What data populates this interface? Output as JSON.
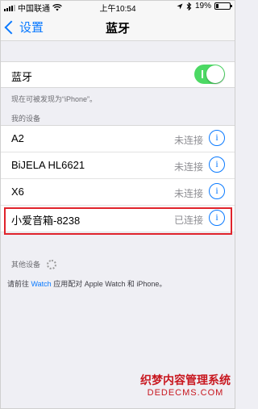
{
  "status_bar": {
    "carrier": "中国联通",
    "time": "上午10:54",
    "battery_text": "19%",
    "battery_level": 0.19,
    "icons": [
      "signal-icon",
      "wifi-icon",
      "location-icon",
      "bluetooth-icon",
      "battery-icon"
    ]
  },
  "nav": {
    "back_label": "设置",
    "title": "蓝牙"
  },
  "bluetooth": {
    "label": "蓝牙",
    "enabled": true
  },
  "discoverable_text": "现在可被发现为“iPhone”。",
  "my_devices": {
    "header": "我的设备",
    "items": [
      {
        "name": "A2",
        "status": "未连接"
      },
      {
        "name": "BiJELA HL6621",
        "status": "未连接"
      },
      {
        "name": "X6",
        "status": "未连接"
      },
      {
        "name": "小爱音箱-8238",
        "status": "已连接"
      }
    ]
  },
  "other_devices_header": "其他设备",
  "watch_hint": {
    "prefix": "请前往 ",
    "link": "Watch",
    "suffix": " 应用配对 Apple Watch 和 iPhone。"
  },
  "watermark": {
    "line1": "织梦内容管理系统",
    "line2": "DEDECMS.COM"
  },
  "colors": {
    "accent": "#0a7aff",
    "toggle_on": "#4cd964",
    "highlight": "#e0232b",
    "background": "#efeff4"
  }
}
